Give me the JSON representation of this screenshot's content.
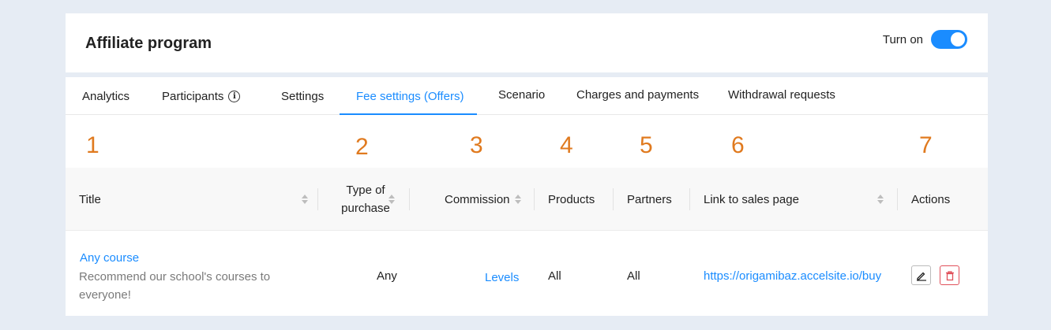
{
  "header": {
    "title": "Affiliate program",
    "toggle_label": "Turn on",
    "toggle_on": true
  },
  "tabs": [
    {
      "label": "Analytics"
    },
    {
      "label": "Participants"
    },
    {
      "label": "Settings"
    },
    {
      "label": "Fee settings (Offers)",
      "active": true
    },
    {
      "label": "Scenario"
    },
    {
      "label": "Charges and payments"
    },
    {
      "label": "Withdrawal requests"
    }
  ],
  "annotations": [
    "1",
    "2",
    "3",
    "4",
    "5",
    "6",
    "7"
  ],
  "table": {
    "columns": [
      {
        "label": "Title",
        "sortable": true
      },
      {
        "label_line1": "Type of",
        "label_line2": "purchase",
        "sortable": true
      },
      {
        "label": "Commission",
        "sortable": true
      },
      {
        "label": "Products",
        "sortable": false
      },
      {
        "label": "Partners",
        "sortable": false
      },
      {
        "label": "Link to sales page",
        "sortable": true
      },
      {
        "label": "Actions",
        "sortable": false
      }
    ],
    "rows": [
      {
        "title": "Any course",
        "description": "Recommend our school's courses to everyone!",
        "type_of_purchase": "Any",
        "commission": "Levels",
        "products": "All",
        "partners": "All",
        "link": "https://origamibaz.accelsite.io/buy"
      }
    ]
  },
  "colors": {
    "accent": "#1a8cff",
    "annotation": "#e07a1f",
    "danger": "#e0505a"
  },
  "icons": [
    "info-icon",
    "sort-icon",
    "edit-icon",
    "trash-icon"
  ]
}
